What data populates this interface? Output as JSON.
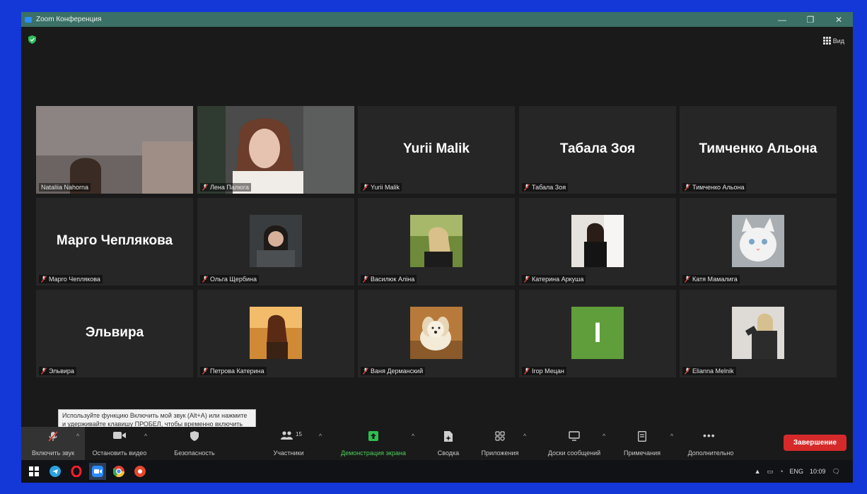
{
  "window": {
    "title": "Zoom Конференция"
  },
  "window_controls": {
    "minimize": "—",
    "maximize": "❐",
    "close": "✕"
  },
  "top": {
    "view_label": "Вид"
  },
  "gallery": {
    "tiles": [
      {
        "name": "Nataliia Nahorna",
        "big_name": "",
        "muted": false,
        "active": true,
        "kind": "video1"
      },
      {
        "name": "Лена Палюга",
        "big_name": "",
        "muted": true,
        "kind": "video2"
      },
      {
        "name": "Yurii Malik",
        "big_name": "Yurii Malik",
        "muted": true,
        "kind": "name"
      },
      {
        "name": "Табала Зоя",
        "big_name": "Табала Зоя",
        "muted": true,
        "kind": "name"
      },
      {
        "name": "Тимченко Альона",
        "big_name": "Тимченко Альона",
        "muted": true,
        "kind": "name"
      },
      {
        "name": "Марго Чеплякова",
        "big_name": "Марго Чеплякова",
        "muted": true,
        "kind": "name"
      },
      {
        "name": "Ольга Щербина",
        "big_name": "",
        "muted": true,
        "kind": "photo",
        "photo": "p-olga"
      },
      {
        "name": "Василюк Аліна",
        "big_name": "",
        "muted": true,
        "kind": "photo",
        "photo": "p-alina"
      },
      {
        "name": "Катерина Аркуша",
        "big_name": "",
        "muted": true,
        "kind": "photo",
        "photo": "p-kateryna"
      },
      {
        "name": "Катя Мамалига",
        "big_name": "",
        "muted": true,
        "kind": "photo",
        "photo": "p-cat"
      },
      {
        "name": "Эльвира",
        "big_name": "Эльвира",
        "muted": true,
        "kind": "name"
      },
      {
        "name": "Петрова Катерина",
        "big_name": "",
        "muted": true,
        "kind": "photo",
        "photo": "p-petrova"
      },
      {
        "name": "Ваня Дерманский",
        "big_name": "",
        "muted": true,
        "kind": "photo",
        "photo": "p-dog"
      },
      {
        "name": "Ігор Мецан",
        "big_name": "",
        "muted": true,
        "kind": "initial",
        "initial": "I",
        "color": "#5f9e3a"
      },
      {
        "name": "Elianna Melnik",
        "big_name": "",
        "muted": true,
        "kind": "photo",
        "photo": "p-elianna"
      }
    ]
  },
  "tooltip": {
    "text": "Используйте функцию Включить мой звук (Alt+A) или нажмите и удерживайте клавишу ПРОБЕЛ, чтобы временно включить звук."
  },
  "toolbar": {
    "audio": "Включить звук",
    "video": "Остановить видео",
    "security": "Безопасность",
    "participants": "Участники",
    "participants_count": "15",
    "share": "Демонстрация экрана",
    "summary": "Сводка",
    "apps": "Приложения",
    "whiteboards": "Доски сообщений",
    "notes": "Примечания",
    "more": "Дополнительно",
    "end": "Завершение"
  },
  "taskbar": {
    "lang": "ENG",
    "time": "10:09"
  },
  "colors": {
    "accent_green": "#4ccf5a",
    "end_red": "#d62a2a",
    "active_border": "#cfe069"
  }
}
